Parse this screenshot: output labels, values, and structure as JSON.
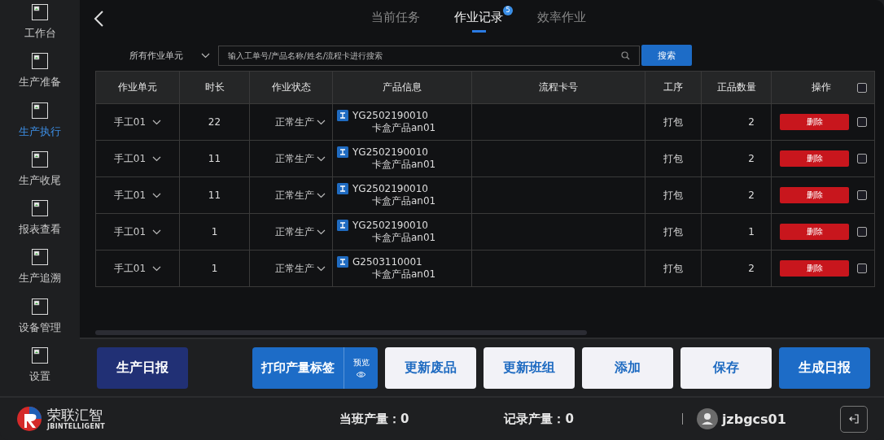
{
  "sidebar": {
    "items": [
      {
        "label": "工作台",
        "selected": false
      },
      {
        "label": "生产准备",
        "selected": false
      },
      {
        "label": "生产执行",
        "selected": true
      },
      {
        "label": "生产收尾",
        "selected": false
      },
      {
        "label": "报表查看",
        "selected": false
      },
      {
        "label": "生产追溯",
        "selected": false
      },
      {
        "label": "设备管理",
        "selected": false
      },
      {
        "label": "设置",
        "selected": false
      }
    ]
  },
  "tabs": [
    {
      "label": "当前任务",
      "selected": false
    },
    {
      "label": "作业记录",
      "selected": true,
      "badge": "5"
    },
    {
      "label": "效率作业",
      "selected": false
    }
  ],
  "filter": {
    "unit_select": "所有作业单元",
    "search": {
      "placeholder": "输入工单号/产品名称/姓名/流程卡进行搜索"
    },
    "search_button": "搜索"
  },
  "table": {
    "columns": [
      "作业单元",
      "时长",
      "作业状态",
      "产品信息",
      "流程卡号",
      "工序",
      "正品数量",
      "操作"
    ],
    "select_all_checked": false,
    "rows": [
      {
        "unit": "手工01",
        "duration": "22",
        "status": "正常生产",
        "code": "YG2502190010",
        "product": "卡盒产品an01",
        "card_no": "",
        "process": "打包",
        "good_qty": "2",
        "action": "删除",
        "checked": false
      },
      {
        "unit": "手工01",
        "duration": "11",
        "status": "正常生产",
        "code": "YG2502190010",
        "product": "卡盒产品an01",
        "card_no": "",
        "process": "打包",
        "good_qty": "2",
        "action": "删除",
        "checked": false
      },
      {
        "unit": "手工01",
        "duration": "11",
        "status": "正常生产",
        "code": "YG2502190010",
        "product": "卡盒产品an01",
        "card_no": "",
        "process": "打包",
        "good_qty": "2",
        "action": "删除",
        "checked": false
      },
      {
        "unit": "手工01",
        "duration": "1",
        "status": "正常生产",
        "code": "YG2502190010",
        "product": "卡盒产品an01",
        "card_no": "",
        "process": "打包",
        "good_qty": "1",
        "action": "删除",
        "checked": false
      },
      {
        "unit": "手工01",
        "duration": "1",
        "status": "正常生产",
        "code": "G2503110001",
        "product": "卡盒产品an01",
        "card_no": "",
        "process": "打包",
        "good_qty": "2",
        "action": "删除",
        "checked": false
      }
    ]
  },
  "actions": [
    {
      "kind": "dark",
      "label": "生产日报"
    },
    {
      "kind": "split",
      "label": "打印产量标签",
      "side_label": "预览"
    },
    {
      "kind": "light",
      "label": "更新废品"
    },
    {
      "kind": "light",
      "label": "更新班组"
    },
    {
      "kind": "light",
      "label": "添加"
    },
    {
      "kind": "light",
      "label": "保存"
    },
    {
      "kind": "primary",
      "label": "生成日报"
    }
  ],
  "status_bar": {
    "logo_name": "荣联汇智",
    "logo_sub": "JBINTELLIGENT",
    "shift_output": "当班产量：0",
    "record_output": "记录产量：0",
    "user": "jzbgcs01"
  }
}
